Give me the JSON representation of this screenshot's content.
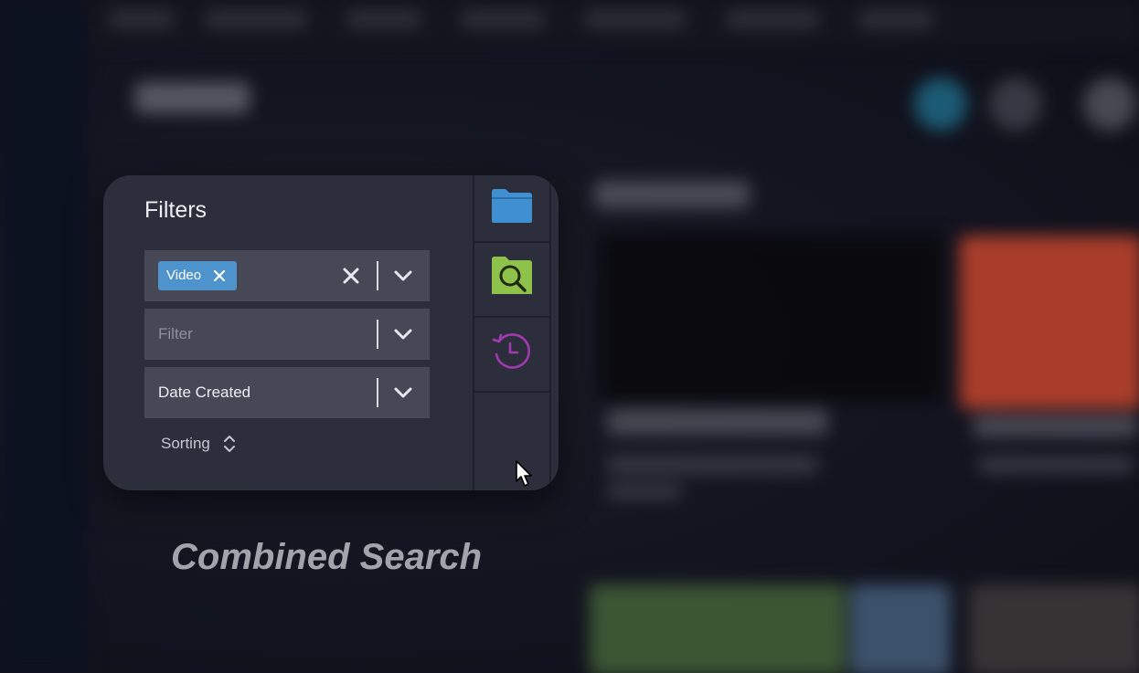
{
  "filters_panel": {
    "title": "Filters",
    "type_field": {
      "tags": [
        {
          "label": "Video"
        }
      ],
      "clear_icon": "close-icon",
      "dropdown_icon": "chevron-down-icon"
    },
    "filter_field": {
      "placeholder": "Filter",
      "dropdown_icon": "chevron-down-icon"
    },
    "date_field": {
      "value": "Date Created",
      "dropdown_icon": "chevron-down-icon"
    },
    "sorting": {
      "label": "Sorting",
      "icon": "sort-arrows-icon"
    },
    "side_buttons": [
      {
        "name": "folder",
        "icon": "folder-icon",
        "color": "#3f8fd1"
      },
      {
        "name": "saved-search",
        "icon": "search-box-icon",
        "color": "#8fc24a"
      },
      {
        "name": "history",
        "icon": "history-icon",
        "color": "#a03ab0"
      }
    ]
  },
  "caption": "Combined Search",
  "colors": {
    "card_bg": "#2d2e3b",
    "field_bg": "#474856",
    "tag_bg": "#4f93cc",
    "caption": "#a3a4ab"
  }
}
